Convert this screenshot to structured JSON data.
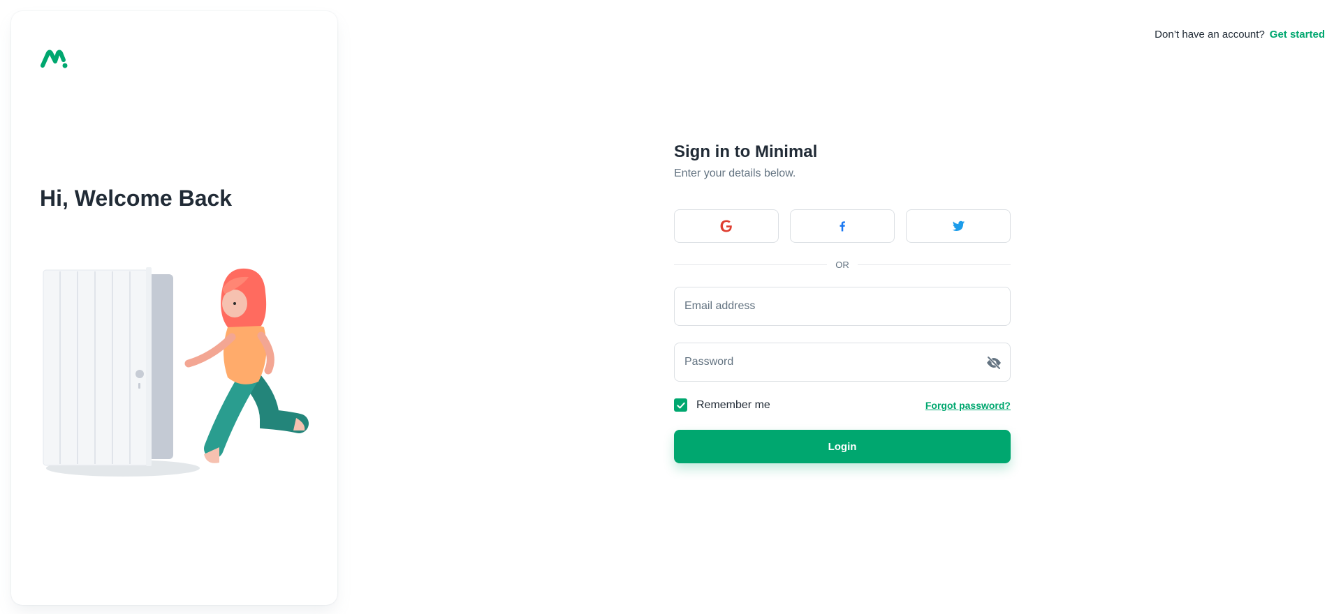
{
  "header": {
    "question": "Don’t have an account?",
    "get_started": "Get started"
  },
  "left": {
    "welcome": "Hi, Welcome Back"
  },
  "form": {
    "title": "Sign in to Minimal",
    "subtitle": "Enter your details below.",
    "divider": "OR",
    "email_placeholder": "Email address",
    "password_placeholder": "Password",
    "remember_label": "Remember me",
    "remember_checked": true,
    "forgot": "Forgot password?",
    "login": "Login"
  },
  "social": [
    {
      "icon": "google-icon",
      "color": "#DF3E30"
    },
    {
      "icon": "facebook-icon",
      "color": "#1877F2"
    },
    {
      "icon": "twitter-icon",
      "color": "#1C9CEA"
    }
  ],
  "colors": {
    "primary": "#00A76F",
    "text": "#212B36",
    "secondary_text": "#637381"
  }
}
